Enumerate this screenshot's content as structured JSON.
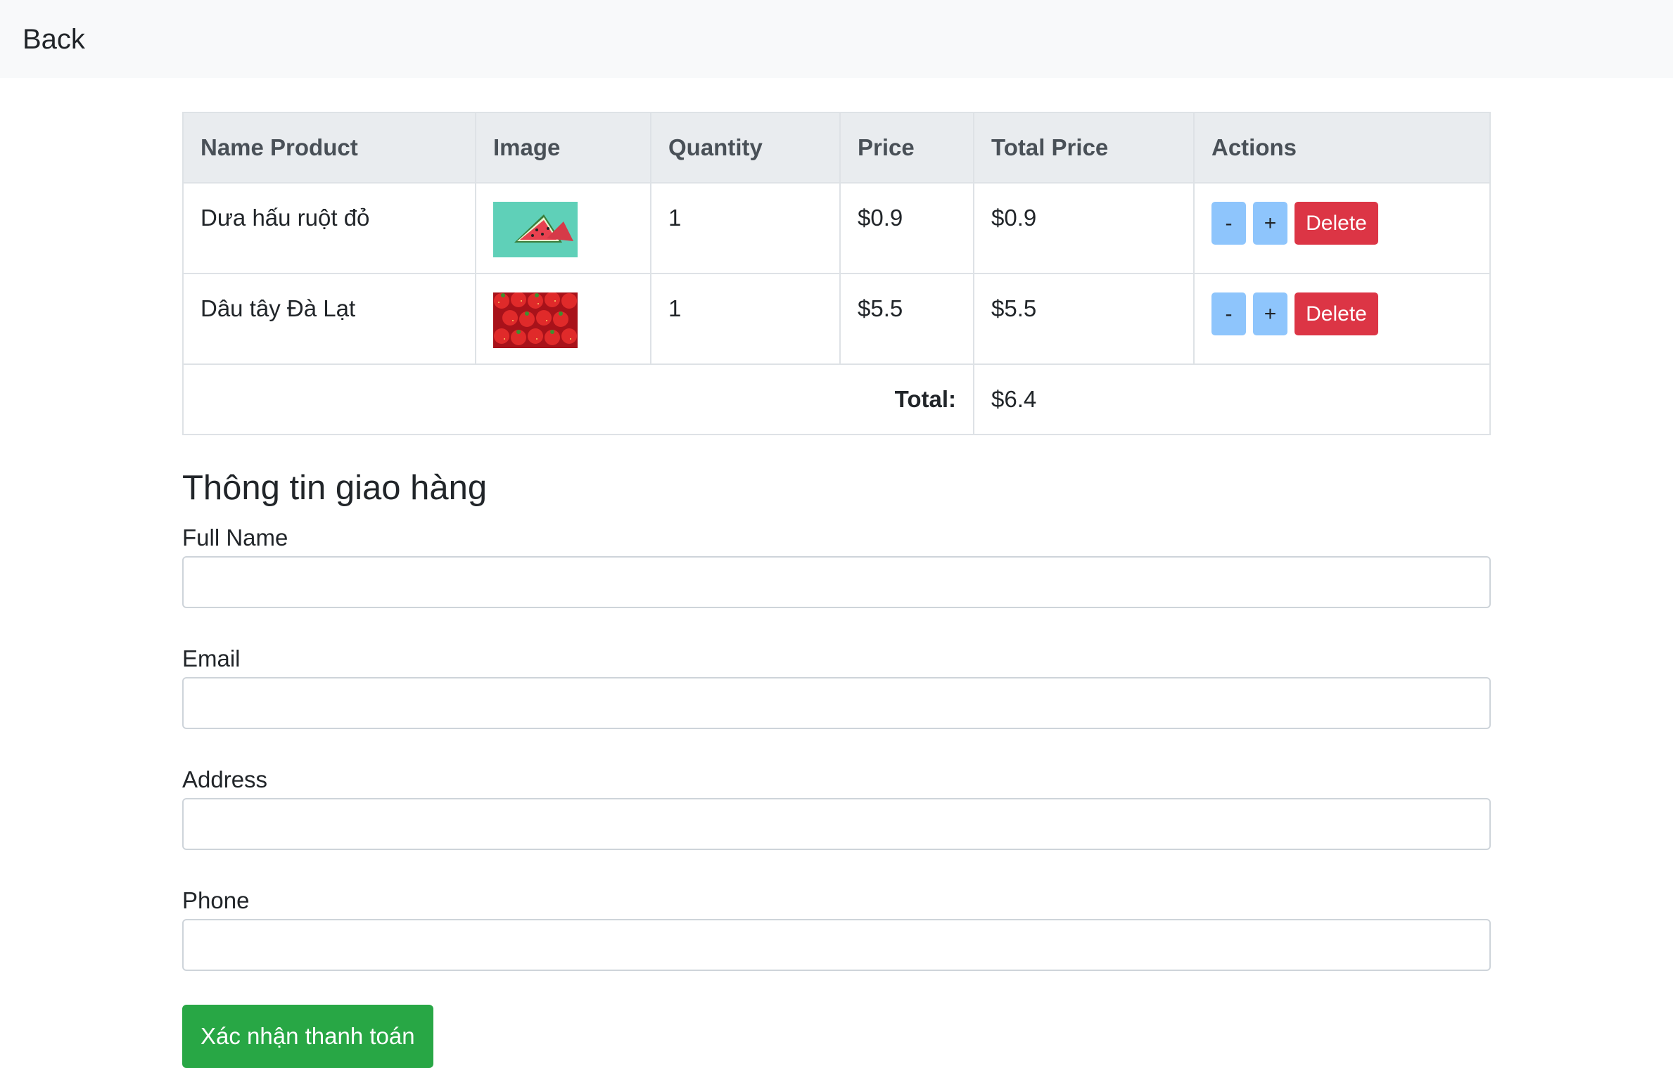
{
  "nav": {
    "back_label": "Back"
  },
  "table": {
    "headers": [
      "Name Product",
      "Image",
      "Quantity",
      "Price",
      "Total Price",
      "Actions"
    ],
    "rows": [
      {
        "name": "Dưa hấu ruột đỏ",
        "image": "watermelon-image",
        "quantity": "1",
        "price": "$0.9",
        "total": "$0.9"
      },
      {
        "name": "Dâu tây Đà Lạt",
        "image": "strawberry-image",
        "quantity": "1",
        "price": "$5.5",
        "total": "$5.5"
      }
    ],
    "actions": {
      "decrease": "-",
      "increase": "+",
      "delete": "Delete"
    },
    "total_label": "Total:",
    "total_value": "$6.4"
  },
  "shipping": {
    "title": "Thông tin giao hàng",
    "full_name_label": "Full Name",
    "email_label": "Email",
    "address_label": "Address",
    "phone_label": "Phone",
    "submit_label": "Xác nhận thanh toán"
  },
  "colors": {
    "navbar_bg": "#f8f9fa",
    "header_bg": "#e9ecef",
    "step_button": "#8ec5fc",
    "delete_button": "#dc3545",
    "submit_button": "#28a745"
  }
}
